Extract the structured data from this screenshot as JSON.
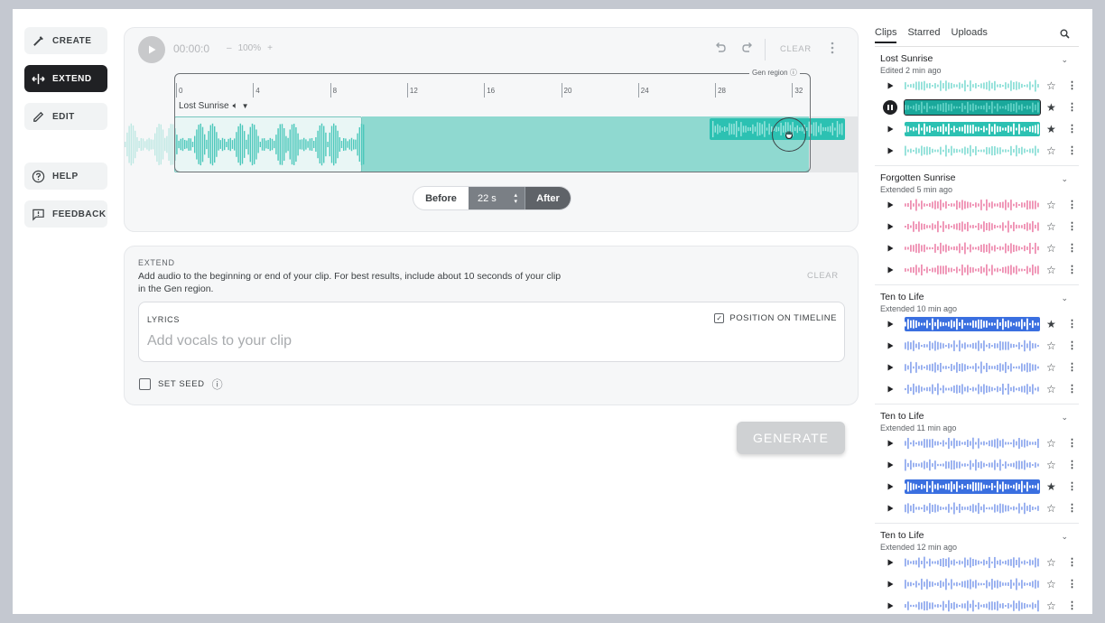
{
  "nav": {
    "create": "CREATE",
    "extend": "EXTEND",
    "edit": "EDIT",
    "help": "HELP",
    "feedback": "FEEDBACK"
  },
  "player": {
    "time": "00:00:0",
    "zoom_minus": "–",
    "zoom": "100%",
    "zoom_plus": "+",
    "clear": "CLEAR"
  },
  "timeline": {
    "ticks": [
      "0",
      "4",
      "8",
      "12",
      "16",
      "20",
      "24",
      "28",
      "32"
    ],
    "gen_region_label": "Gen region",
    "clip_name": "Lost Sunrise",
    "position_fraction": 0.81
  },
  "before_after": {
    "before": "Before",
    "value": "22 s",
    "after": "After"
  },
  "extend": {
    "title": "EXTEND",
    "description": "Add audio to the beginning or end of your clip. For best results, include about 10 seconds of your clip in the Gen region.",
    "clear": "CLEAR",
    "lyrics_label": "LYRICS",
    "lyrics_placeholder": "Add vocals to your clip",
    "position_on_timeline": "POSITION ON TIMELINE",
    "position_on_timeline_checked": true,
    "set_seed": "SET SEED",
    "set_seed_checked": false
  },
  "generate": "GENERATE",
  "library": {
    "tabs": [
      "Clips",
      "Starred",
      "Uploads"
    ],
    "active_tab": "Clips",
    "groups": [
      {
        "title": "Lost Sunrise",
        "subtitle": "Edited 2 min ago",
        "clips": [
          {
            "starred": false,
            "selected": false,
            "playing": false,
            "color": "#8fe0d8",
            "bg": "#ffffff"
          },
          {
            "starred": true,
            "selected": true,
            "playing": true,
            "color": "#5fd0c4",
            "bg": "#1aa89b"
          },
          {
            "starred": true,
            "selected": false,
            "playing": false,
            "color": "#ffffff",
            "bg": "#2cc1b2"
          },
          {
            "starred": false,
            "selected": false,
            "playing": false,
            "color": "#8fe0d8",
            "bg": "#ffffff"
          }
        ]
      },
      {
        "title": "Forgotten Sunrise",
        "subtitle": "Extended 5 min ago",
        "clips": [
          {
            "starred": false,
            "selected": false,
            "playing": false,
            "color": "#ee8fb2",
            "bg": "#ffffff"
          },
          {
            "starred": false,
            "selected": false,
            "playing": false,
            "color": "#ee8fb2",
            "bg": "#ffffff"
          },
          {
            "starred": false,
            "selected": false,
            "playing": false,
            "color": "#ee8fb2",
            "bg": "#ffffff"
          },
          {
            "starred": false,
            "selected": false,
            "playing": false,
            "color": "#ee8fb2",
            "bg": "#ffffff"
          }
        ]
      },
      {
        "title": "Ten to Life",
        "subtitle": "Extended 10 min ago",
        "clips": [
          {
            "starred": true,
            "selected": false,
            "playing": false,
            "color": "#ffffff",
            "bg": "#3a6fe0"
          },
          {
            "starred": false,
            "selected": false,
            "playing": false,
            "color": "#93acef",
            "bg": "#ffffff"
          },
          {
            "starred": false,
            "selected": false,
            "playing": false,
            "color": "#93acef",
            "bg": "#ffffff"
          },
          {
            "starred": false,
            "selected": false,
            "playing": false,
            "color": "#93acef",
            "bg": "#ffffff"
          }
        ]
      },
      {
        "title": "Ten to Life",
        "subtitle": "Extended 11 min ago",
        "clips": [
          {
            "starred": false,
            "selected": false,
            "playing": false,
            "color": "#93acef",
            "bg": "#ffffff"
          },
          {
            "starred": false,
            "selected": false,
            "playing": false,
            "color": "#93acef",
            "bg": "#ffffff"
          },
          {
            "starred": true,
            "selected": false,
            "playing": false,
            "color": "#ffffff",
            "bg": "#3a6fe0"
          },
          {
            "starred": false,
            "selected": false,
            "playing": false,
            "color": "#93acef",
            "bg": "#ffffff"
          }
        ]
      },
      {
        "title": "Ten to Life",
        "subtitle": "Extended 12 min ago",
        "clips": [
          {
            "starred": false,
            "selected": false,
            "playing": false,
            "color": "#93acef",
            "bg": "#ffffff"
          },
          {
            "starred": false,
            "selected": false,
            "playing": false,
            "color": "#93acef",
            "bg": "#ffffff"
          },
          {
            "starred": false,
            "selected": false,
            "playing": false,
            "color": "#93acef",
            "bg": "#ffffff"
          }
        ]
      }
    ]
  },
  "colors": {
    "accent_dark": "#202124",
    "teal": "#2cc1b2",
    "teal_light": "#8fd9d0",
    "pink": "#ee8fb2",
    "blue": "#3a6fe0",
    "blue_light": "#93acef"
  }
}
